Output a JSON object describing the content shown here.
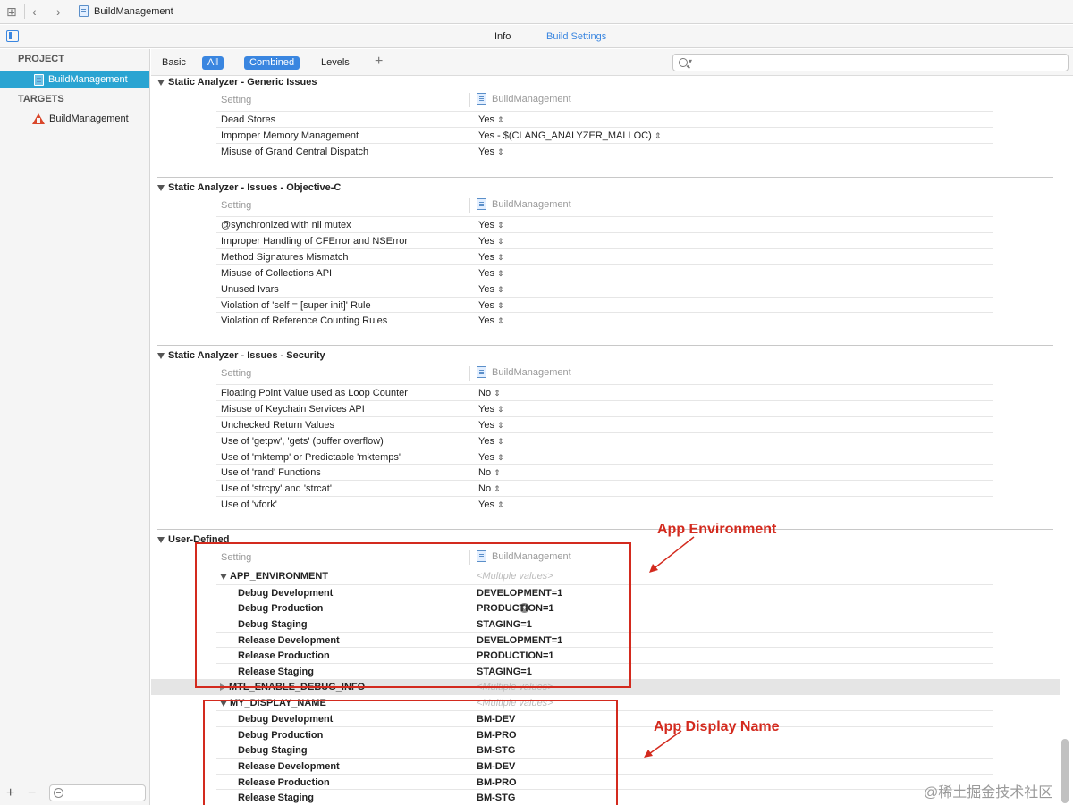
{
  "topbar": {
    "project_name": "BuildManagement"
  },
  "tabs": {
    "info": "Info",
    "build_settings": "Build Settings"
  },
  "sidebar": {
    "project_header": "PROJECT",
    "project_item": "BuildManagement",
    "targets_header": "TARGETS",
    "target_item": "BuildManagement",
    "add": "+",
    "remove": "−"
  },
  "filterbar": {
    "basic": "Basic",
    "all": "All",
    "combined": "Combined",
    "levels": "Levels",
    "add": "+",
    "search_placeholder": ""
  },
  "columns": {
    "setting": "Setting",
    "project": "BuildManagement"
  },
  "sections": [
    {
      "title": "Static Analyzer - Generic Issues",
      "rows": [
        {
          "name": "Dead Stores",
          "value": "Yes"
        },
        {
          "name": "Improper Memory Management",
          "value": "Yes  -  $(CLANG_ANALYZER_MALLOC)"
        },
        {
          "name": "Misuse of Grand Central Dispatch",
          "value": "Yes"
        }
      ]
    },
    {
      "title": "Static Analyzer - Issues - Objective-C",
      "rows": [
        {
          "name": "@synchronized with nil mutex",
          "value": "Yes"
        },
        {
          "name": "Improper Handling of CFError and NSError",
          "value": "Yes"
        },
        {
          "name": "Method Signatures Mismatch",
          "value": "Yes"
        },
        {
          "name": "Misuse of Collections API",
          "value": "Yes"
        },
        {
          "name": "Unused Ivars",
          "value": "Yes"
        },
        {
          "name": "Violation of 'self = [super init]' Rule",
          "value": "Yes"
        },
        {
          "name": "Violation of Reference Counting Rules",
          "value": "Yes"
        }
      ]
    },
    {
      "title": "Static Analyzer - Issues - Security",
      "rows": [
        {
          "name": "Floating Point Value used as Loop Counter",
          "value": "No"
        },
        {
          "name": "Misuse of Keychain Services API",
          "value": "Yes"
        },
        {
          "name": "Unchecked Return Values",
          "value": "Yes"
        },
        {
          "name": "Use of 'getpw', 'gets' (buffer overflow)",
          "value": "Yes"
        },
        {
          "name": "Use of 'mktemp' or Predictable 'mktemps'",
          "value": "Yes"
        },
        {
          "name": "Use of 'rand' Functions",
          "value": "No"
        },
        {
          "name": "Use of 'strcpy' and 'strcat'",
          "value": "No"
        },
        {
          "name": "Use of 'vfork'",
          "value": "Yes"
        }
      ]
    }
  ],
  "user_defined": {
    "title": "User-Defined",
    "app_environment": {
      "name": "APP_ENVIRONMENT",
      "summary": "<Multiple values>",
      "rows": [
        {
          "name": "Debug Development",
          "value": "DEVELOPMENT=1"
        },
        {
          "name": "Debug Production",
          "value": "PRODUCTION=1"
        },
        {
          "name": "Debug Staging",
          "value": "STAGING=1"
        },
        {
          "name": "Release Development",
          "value": "DEVELOPMENT=1"
        },
        {
          "name": "Release Production",
          "value": "PRODUCTION=1"
        },
        {
          "name": "Release Staging",
          "value": "STAGING=1"
        }
      ]
    },
    "mtl": {
      "name": "MTL_ENABLE_DEBUG_INFO",
      "summary": "<Multiple values>"
    },
    "my_display_name": {
      "name": "MY_DISPLAY_NAME",
      "summary": "<Multiple values>",
      "rows": [
        {
          "name": "Debug Development",
          "value": "BM-DEV"
        },
        {
          "name": "Debug Production",
          "value": "BM-PRO"
        },
        {
          "name": "Debug Staging",
          "value": "BM-STG"
        },
        {
          "name": "Release Development",
          "value": "BM-DEV"
        },
        {
          "name": "Release Production",
          "value": "BM-PRO"
        },
        {
          "name": "Release Staging",
          "value": "BM-STG"
        }
      ]
    }
  },
  "annotations": {
    "app_environment": "App Environment",
    "app_display_name": "App Display Name",
    "color": "#d32a1e"
  },
  "watermark": "@稀土掘金技术社区",
  "colors": {
    "accent": "#3a86e0",
    "selection": "#2aa4d2"
  }
}
